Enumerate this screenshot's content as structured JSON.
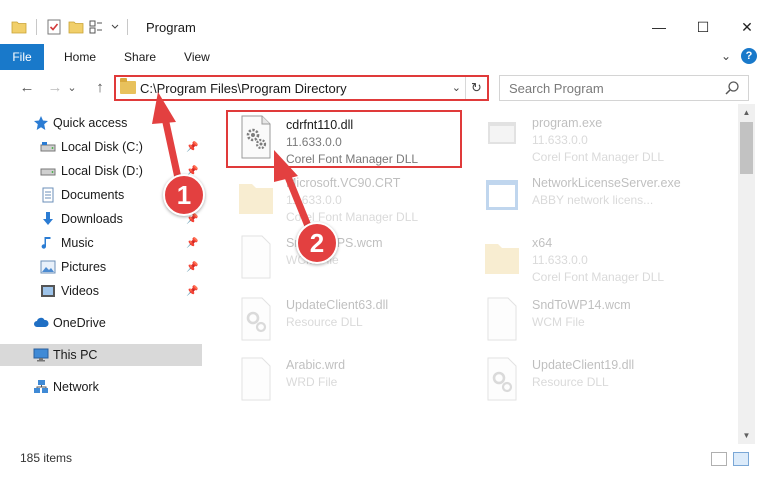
{
  "window": {
    "title": "Program",
    "minimize": "—",
    "maximize": "☐",
    "close": "✕"
  },
  "ribbon": {
    "tabs": [
      "File",
      "Home",
      "Share",
      "View"
    ],
    "expand": "⌄",
    "help": "?"
  },
  "nav": {
    "back": "←",
    "forward": "→",
    "recent": "⌄",
    "up": "↑"
  },
  "address": {
    "path": "C:\\Program Files\\Program Directory",
    "dropdown": "⌄",
    "refresh": "↻"
  },
  "search": {
    "placeholder": "Search Program"
  },
  "sidebar": {
    "items": [
      {
        "label": "Quick access",
        "icon": "star-icon"
      },
      {
        "label": "Local Disk (C:)",
        "icon": "drive-icon",
        "pinned": true
      },
      {
        "label": "Local Disk (D:)",
        "icon": "drive-icon",
        "pinned": true
      },
      {
        "label": "Documents",
        "icon": "documents-icon",
        "pinned": true
      },
      {
        "label": "Downloads",
        "icon": "downloads-icon",
        "pinned": true
      },
      {
        "label": "Music",
        "icon": "music-icon",
        "pinned": true
      },
      {
        "label": "Pictures",
        "icon": "pictures-icon",
        "pinned": true
      },
      {
        "label": "Videos",
        "icon": "videos-icon",
        "pinned": true
      },
      {
        "label": "OneDrive",
        "icon": "cloud-icon"
      },
      {
        "label": "This PC",
        "icon": "computer-icon",
        "selected": true
      },
      {
        "label": "Network",
        "icon": "network-icon"
      }
    ],
    "pin_glyph": "📌"
  },
  "files": [
    {
      "name": "cdrfnt110.dll",
      "line1": "11.633.0.0",
      "line2": "Corel Font Manager DLL",
      "icon": "dll-gear-icon",
      "highlighted": true
    },
    {
      "name": "program.exe",
      "line1": "11.633.0.0",
      "line2": "Corel Font Manager DLL",
      "icon": "exe-icon"
    },
    {
      "name": "Microsoft.VC90.CRT",
      "line1": "11.633.0.0",
      "line2": "Corel Font Manager DLL",
      "icon": "folder-icon"
    },
    {
      "name": "NetworkLicenseServer.exe",
      "line1": "ABBY network licens...",
      "line2": "",
      "icon": "exe-window-icon"
    },
    {
      "name": "SndToFTPS.wcm",
      "line1": "WCM File",
      "line2": "",
      "icon": "file-icon"
    },
    {
      "name": "x64",
      "line1": "11.633.0.0",
      "line2": "Corel Font Manager DLL",
      "icon": "folder-icon"
    },
    {
      "name": "UpdateClient63.dll",
      "line1": "Resource DLL",
      "line2": "",
      "icon": "dll-gear-icon"
    },
    {
      "name": "SndToWP14.wcm",
      "line1": "WCM File",
      "line2": "",
      "icon": "file-icon"
    },
    {
      "name": "Arabic.wrd",
      "line1": "WRD File",
      "line2": "",
      "icon": "file-icon"
    },
    {
      "name": "UpdateClient19.dll",
      "line1": "Resource DLL",
      "line2": "",
      "icon": "dll-gear-icon"
    }
  ],
  "status": {
    "item_count": "185 items"
  },
  "annotations": {
    "step1": "1",
    "step2": "2"
  },
  "colors": {
    "accent": "#1979ca",
    "annotation_red": "#e03a3a",
    "folder": "#e8c15c"
  }
}
